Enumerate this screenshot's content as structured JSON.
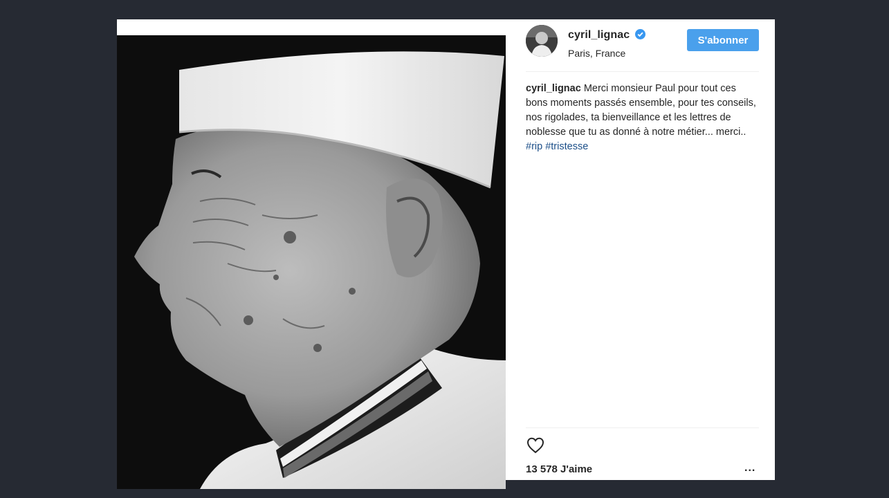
{
  "post": {
    "username": "cyril_lignac",
    "verified": true,
    "location": "Paris, France",
    "follow_label": "S'abonner",
    "caption": {
      "username": "cyril_lignac",
      "text": "Merci monsieur Paul pour tout ces bons moments passés ensemble, pour tes conseils, nos rigolades, ta bienveillance et les lettres de noblesse que tu as donné à notre métier... merci..",
      "hashtags": [
        "#rip",
        "#tristesse"
      ]
    },
    "likes_label": "13 578 J'aime",
    "more_label": "...",
    "icons": {
      "verified": "verified-badge-icon",
      "like": "heart-outline-icon",
      "more": "more-options-icon"
    }
  },
  "colors": {
    "page_background": "#262a33",
    "card_background": "#ffffff",
    "follow_button": "#4aa0ec",
    "hashtag": "#1c4f89",
    "verified_badge": "#3897f0"
  }
}
